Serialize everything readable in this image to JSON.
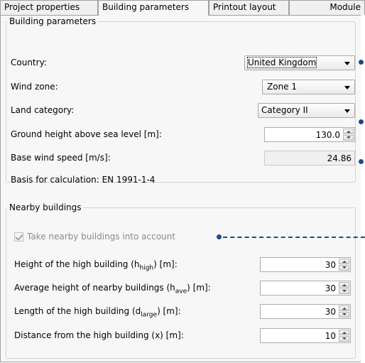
{
  "tabs": [
    "Project properties",
    "Building parameters",
    "Printout layout",
    "Module"
  ],
  "building": {
    "title": "Building parameters",
    "country_label": "Country:",
    "country_value": "United Kingdom",
    "wind_zone_label": "Wind zone:",
    "wind_zone_value": "Zone 1",
    "land_label": "Land category:",
    "land_value": "Category II",
    "ground_label": "Ground height above sea level [m]:",
    "ground_value": "130.0",
    "wind_speed_label": "Base wind speed [m/s]:",
    "wind_speed_value": "24.86",
    "basis": "Basis for calculation: EN 1991-1-4"
  },
  "nearby": {
    "title": "Nearby buildings",
    "take_label": "Take nearby buildings into account",
    "take_checked": true,
    "height_pre": "Height of the high building (h",
    "height_sub": "high",
    "height_post": ") [m]:",
    "height_value": "30",
    "avg_pre": "Average height of nearby buildings (h",
    "avg_sub": "ave",
    "avg_post": ") [m]:",
    "avg_value": "30",
    "len_pre": "Length of the high building (d",
    "len_sub": "large",
    "len_post": ") [m]:",
    "len_value": "30",
    "dist_label": "Distance from the high building (x) [m]:",
    "dist_value": "10"
  },
  "colors": {
    "callout": "#1a4d8c"
  }
}
